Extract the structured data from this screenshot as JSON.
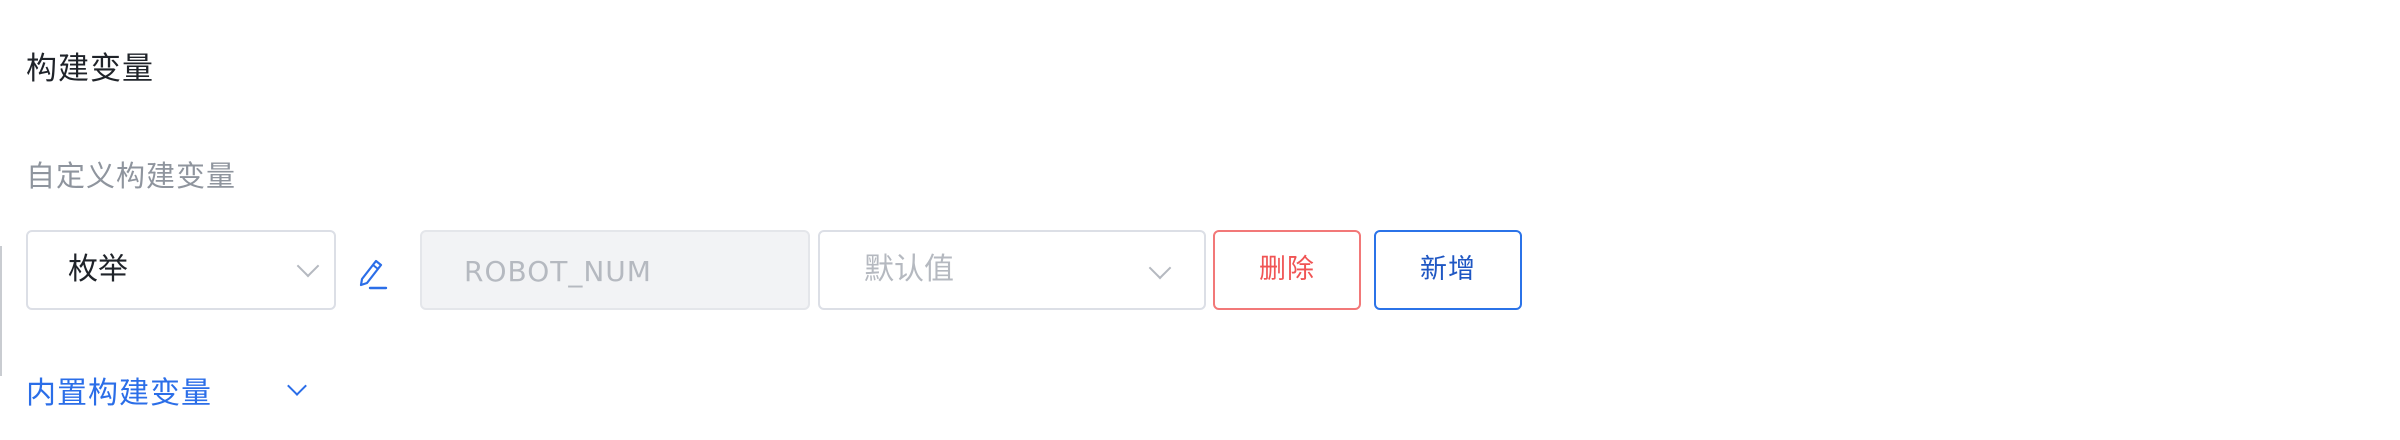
{
  "section": {
    "title": "构建变量",
    "subtitle": "自定义构建变量"
  },
  "variable_row": {
    "type_select": {
      "value": "枚举",
      "icon": "chevron-down-icon"
    },
    "edit_icon": "pencil-icon",
    "name_input": {
      "value": "ROBOT_NUM"
    },
    "default_select": {
      "placeholder": "默认值",
      "icon": "chevron-down-icon"
    },
    "delete_label": "删除",
    "add_label": "新增"
  },
  "builtin": {
    "label": "内置构建变量",
    "icon": "chevron-down-icon"
  },
  "colors": {
    "accent": "#2b6ee8",
    "danger": "#f05454",
    "border": "#dcdfe6",
    "disabled_bg": "#f2f3f5",
    "placeholder": "#b5b9c0"
  }
}
